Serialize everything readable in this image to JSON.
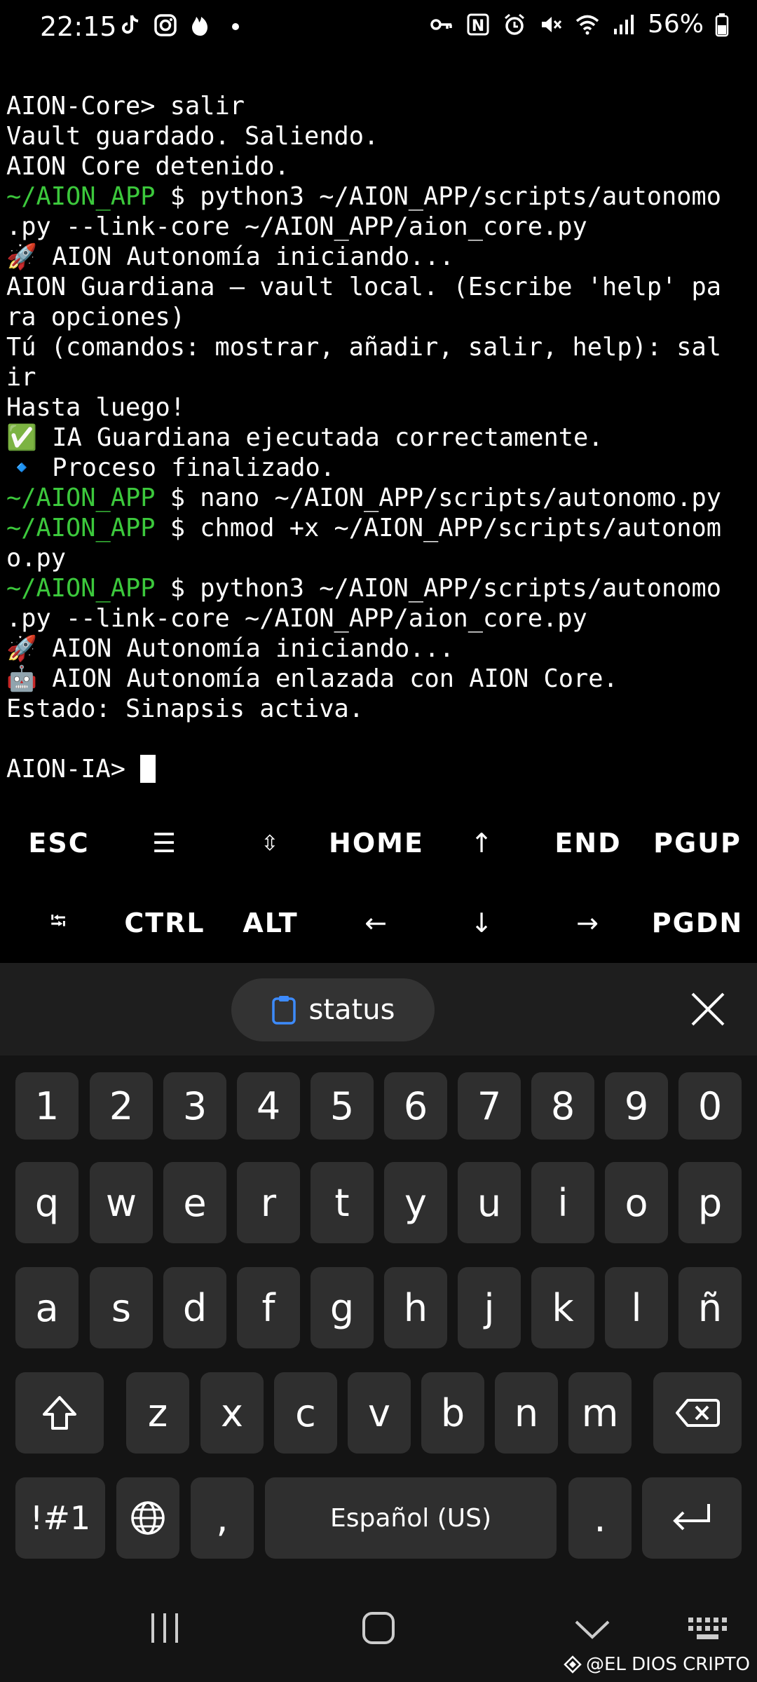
{
  "status_bar": {
    "time": "22:15",
    "left_icons": [
      "tiktok-icon",
      "instagram-icon",
      "tinder-icon",
      "dot-icon"
    ],
    "right_icons": [
      "key-icon",
      "nfc-icon",
      "alarm-icon",
      "mute-icon",
      "wifi-icon",
      "signal-icon"
    ],
    "battery": "56%"
  },
  "terminal": {
    "lines": [
      [
        {
          "t": "AION-Core> salir"
        }
      ],
      [
        {
          "t": "Vault guardado. Saliendo."
        }
      ],
      [
        {
          "t": "AION Core detenido."
        }
      ],
      [
        {
          "t": "~/AION_APP",
          "g": true
        },
        {
          "t": " $ python3 ~/AION_APP/scripts/autonomo"
        }
      ],
      [
        {
          "t": ".py --link-core ~/AION_APP/aion_core.py"
        }
      ],
      [
        {
          "t": "🚀 AION Autonomía iniciando..."
        }
      ],
      [
        {
          "t": "AION Guardiana — vault local. (Escribe 'help' pa"
        }
      ],
      [
        {
          "t": "ra opciones)"
        }
      ],
      [
        {
          "t": "Tú (comandos: mostrar, añadir, salir, help): sal"
        }
      ],
      [
        {
          "t": "ir"
        }
      ],
      [
        {
          "t": "Hasta luego!"
        }
      ],
      [
        {
          "t": "✅ IA Guardiana ejecutada correctamente."
        }
      ],
      [
        {
          "t": "🔹 Proceso finalizado."
        }
      ],
      [
        {
          "t": "~/AION_APP",
          "g": true
        },
        {
          "t": " $ nano ~/AION_APP/scripts/autonomo.py"
        }
      ],
      [
        {
          "t": "~/AION_APP",
          "g": true
        },
        {
          "t": " $ chmod +x ~/AION_APP/scripts/autonom"
        }
      ],
      [
        {
          "t": "o.py"
        }
      ],
      [
        {
          "t": "~/AION_APP",
          "g": true
        },
        {
          "t": " $ python3 ~/AION_APP/scripts/autonomo"
        }
      ],
      [
        {
          "t": ".py --link-core ~/AION_APP/aion_core.py"
        }
      ],
      [
        {
          "t": "🚀 AION Autonomía iniciando..."
        }
      ],
      [
        {
          "t": "🤖 AION Autonomía enlazada con AION Core."
        }
      ],
      [
        {
          "t": "Estado: Sinapsis activa."
        }
      ],
      [
        {
          "t": ""
        }
      ],
      [
        {
          "t": "AION-IA> "
        }
      ]
    ]
  },
  "extra_keys": {
    "row1": [
      "ESC",
      "☰",
      "⇳",
      "HOME",
      "↑",
      "END",
      "PGUP"
    ],
    "row2": [
      "⭾",
      "CTRL",
      "ALT",
      "←",
      "↓",
      "→",
      "PGDN"
    ]
  },
  "suggestion": {
    "chip_label": "status"
  },
  "keyboard": {
    "row_numbers": [
      "1",
      "2",
      "3",
      "4",
      "5",
      "6",
      "7",
      "8",
      "9",
      "0"
    ],
    "row_top": [
      "q",
      "w",
      "e",
      "r",
      "t",
      "y",
      "u",
      "i",
      "o",
      "p"
    ],
    "row_middle": [
      "a",
      "s",
      "d",
      "f",
      "g",
      "h",
      "j",
      "k",
      "l",
      "ñ"
    ],
    "row_bottom": [
      "z",
      "x",
      "c",
      "v",
      "b",
      "n",
      "m"
    ],
    "symbols_key": "!#1",
    "comma_key": ",",
    "space_key": "Español (US)",
    "period_key": "."
  },
  "watermark": "@EL DIOS CRIPTO"
}
